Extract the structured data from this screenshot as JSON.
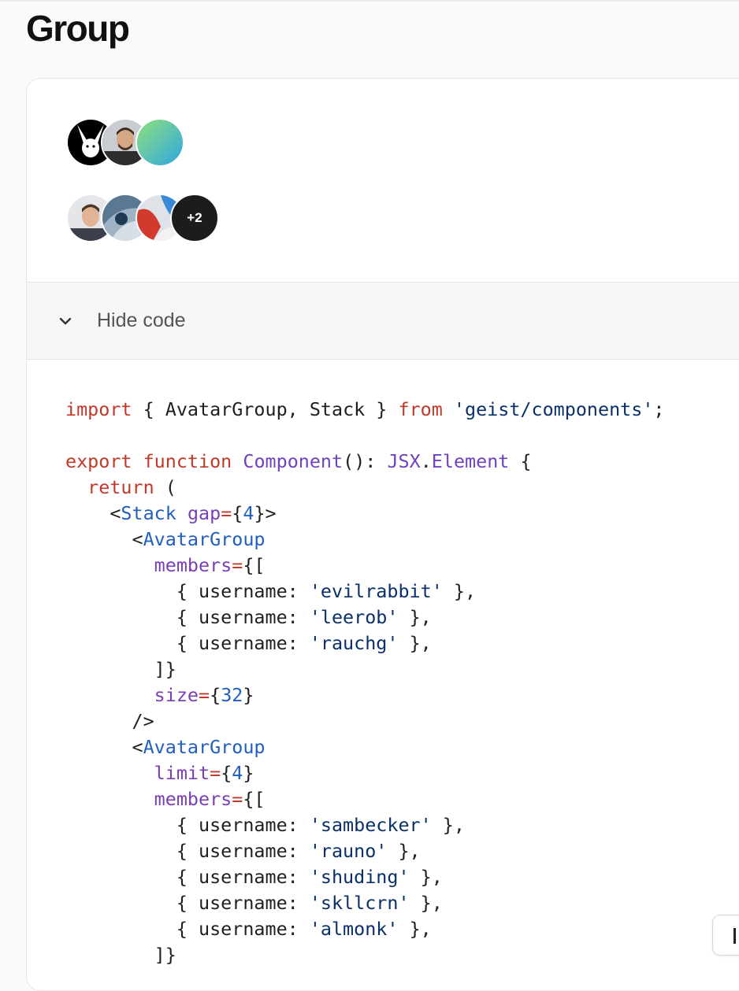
{
  "page": {
    "title": "Group"
  },
  "preview": {
    "group1": {
      "avatars": [
        "evilrabbit-avatar",
        "leerob-avatar",
        "rauchg-avatar"
      ]
    },
    "group2": {
      "avatars": [
        "sambecker-avatar",
        "rauno-avatar",
        "shuding-avatar"
      ],
      "more_label": "+2"
    }
  },
  "toggle": {
    "label": "Hide code",
    "icon": "chevron-down-icon"
  },
  "code": {
    "lines": [
      [
        [
          "kw",
          "import"
        ],
        [
          "p",
          " { AvatarGroup, Stack } "
        ],
        [
          "kw",
          "from"
        ],
        [
          "p",
          " "
        ],
        [
          "str",
          "'geist/components'"
        ],
        [
          "p",
          ";"
        ]
      ],
      [],
      [
        [
          "kw",
          "export"
        ],
        [
          "p",
          " "
        ],
        [
          "kw",
          "function"
        ],
        [
          "p",
          " "
        ],
        [
          "fn",
          "Component"
        ],
        [
          "p",
          "(): "
        ],
        [
          "fn",
          "JSX"
        ],
        [
          "p",
          "."
        ],
        [
          "fn",
          "Element"
        ],
        [
          "p",
          " {"
        ]
      ],
      [
        [
          "p",
          "  "
        ],
        [
          "kw",
          "return"
        ],
        [
          "p",
          " ("
        ]
      ],
      [
        [
          "p",
          "    <"
        ],
        [
          "tag",
          "Stack"
        ],
        [
          "p",
          " "
        ],
        [
          "attr",
          "gap"
        ],
        [
          "kw",
          "="
        ],
        [
          "p",
          "{"
        ],
        [
          "num",
          "4"
        ],
        [
          "p",
          "}>"
        ]
      ],
      [
        [
          "p",
          "      <"
        ],
        [
          "tag",
          "AvatarGroup"
        ]
      ],
      [
        [
          "p",
          "        "
        ],
        [
          "attr",
          "members"
        ],
        [
          "kw",
          "="
        ],
        [
          "p",
          "{["
        ]
      ],
      [
        [
          "p",
          "          { username: "
        ],
        [
          "str",
          "'evilrabbit'"
        ],
        [
          "p",
          " },"
        ]
      ],
      [
        [
          "p",
          "          { username: "
        ],
        [
          "str",
          "'leerob'"
        ],
        [
          "p",
          " },"
        ]
      ],
      [
        [
          "p",
          "          { username: "
        ],
        [
          "str",
          "'rauchg'"
        ],
        [
          "p",
          " },"
        ]
      ],
      [
        [
          "p",
          "        ]}"
        ]
      ],
      [
        [
          "p",
          "        "
        ],
        [
          "attr",
          "size"
        ],
        [
          "kw",
          "="
        ],
        [
          "p",
          "{"
        ],
        [
          "num",
          "32"
        ],
        [
          "p",
          "}"
        ]
      ],
      [
        [
          "p",
          "      />"
        ]
      ],
      [
        [
          "p",
          "      <"
        ],
        [
          "tag",
          "AvatarGroup"
        ]
      ],
      [
        [
          "p",
          "        "
        ],
        [
          "attr",
          "limit"
        ],
        [
          "kw",
          "="
        ],
        [
          "p",
          "{"
        ],
        [
          "num",
          "4"
        ],
        [
          "p",
          "}"
        ]
      ],
      [
        [
          "p",
          "        "
        ],
        [
          "attr",
          "members"
        ],
        [
          "kw",
          "="
        ],
        [
          "p",
          "{["
        ]
      ],
      [
        [
          "p",
          "          { username: "
        ],
        [
          "str",
          "'sambecker'"
        ],
        [
          "p",
          " },"
        ]
      ],
      [
        [
          "p",
          "          { username: "
        ],
        [
          "str",
          "'rauno'"
        ],
        [
          "p",
          " },"
        ]
      ],
      [
        [
          "p",
          "          { username: "
        ],
        [
          "str",
          "'shuding'"
        ],
        [
          "p",
          " },"
        ]
      ],
      [
        [
          "p",
          "          { username: "
        ],
        [
          "str",
          "'skllcrn'"
        ],
        [
          "p",
          " },"
        ]
      ],
      [
        [
          "p",
          "          { username: "
        ],
        [
          "str",
          "'almonk'"
        ],
        [
          "p",
          " },"
        ]
      ],
      [
        [
          "p",
          "        ]}"
        ]
      ]
    ]
  },
  "colors": {
    "keyword": "#c0392b",
    "string": "#0a3069",
    "function": "#6f42c1",
    "tag": "#1f5fbf",
    "attribute": "#7a3fb5"
  }
}
